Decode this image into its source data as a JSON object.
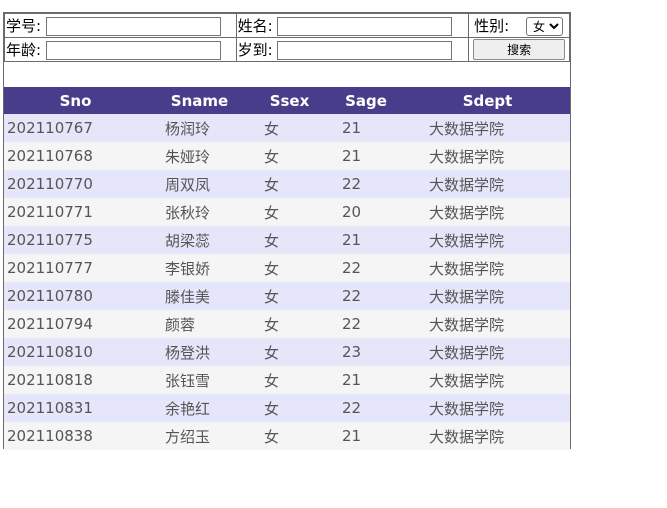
{
  "search": {
    "sno_label": "学号:",
    "sname_label": "姓名:",
    "ssex_label": "性别:",
    "ssex_options": [
      "女"
    ],
    "ssex_selected": "女",
    "sage_label": "年龄:",
    "sage_to_label": "岁到:",
    "search_button": "搜索",
    "sno_value": "",
    "sname_value": "",
    "sage_from_value": "",
    "sage_to_value": ""
  },
  "table": {
    "columns": [
      "Sno",
      "Sname",
      "Ssex",
      "Sage",
      "Sdept"
    ],
    "rows": [
      [
        "202110767",
        "杨润玲",
        "女",
        "21",
        "大数据学院"
      ],
      [
        "202110768",
        "朱娅玲",
        "女",
        "21",
        "大数据学院"
      ],
      [
        "202110770",
        "周双凤",
        "女",
        "22",
        "大数据学院"
      ],
      [
        "202110771",
        "张秋玲",
        "女",
        "20",
        "大数据学院"
      ],
      [
        "202110775",
        "胡梁蕊",
        "女",
        "21",
        "大数据学院"
      ],
      [
        "202110777",
        "李银娇",
        "女",
        "22",
        "大数据学院"
      ],
      [
        "202110780",
        "滕佳美",
        "女",
        "22",
        "大数据学院"
      ],
      [
        "202110794",
        "颜蓉",
        "女",
        "22",
        "大数据学院"
      ],
      [
        "202110810",
        "杨登洪",
        "女",
        "23",
        "大数据学院"
      ],
      [
        "202110818",
        "张钰雪",
        "女",
        "21",
        "大数据学院"
      ],
      [
        "202110831",
        "余艳红",
        "女",
        "22",
        "大数据学院"
      ],
      [
        "202110838",
        "方绍玉",
        "女",
        "21",
        "大数据学院"
      ]
    ]
  },
  "colors": {
    "header_bg": "#483d8b",
    "row_odd": "#e6e6fa",
    "row_even": "#f5f5f5"
  }
}
